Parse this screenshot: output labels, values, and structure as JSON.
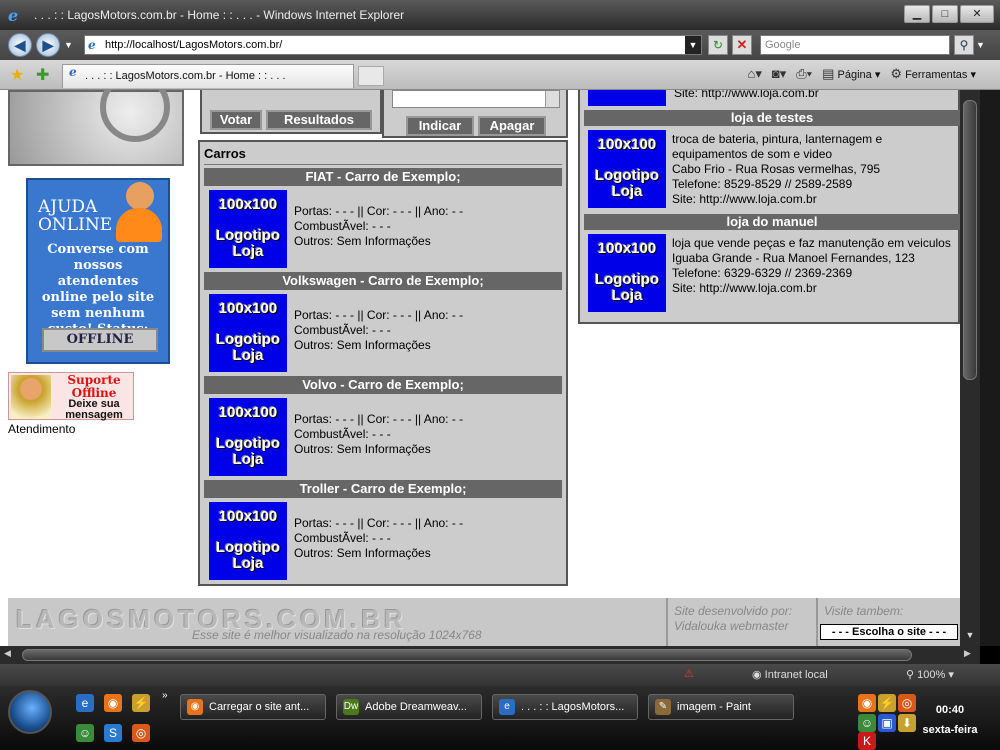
{
  "window": {
    "title": ". . . : : LagosMotors.com.br - Home : : . . . - Windows Internet Explorer",
    "minimize": "▁",
    "maximize": "□",
    "close": "✕"
  },
  "browser": {
    "address": "http://localhost/LagosMotors.com.br/",
    "search_placeholder": "Google",
    "tab_title": ". . . : : LagosMotors.com.br - Home : : . . .",
    "menu_pagina": "Página",
    "menu_ferramentas": "Ferramentas",
    "status_zone": "Intranet local",
    "zoom": "100%"
  },
  "left": {
    "ajuda_title": "AJUDA ONLINE",
    "ajuda_text": "Converse com nossos atendentes online pelo site sem nenhum custo! Status:",
    "status_button": "OFFLINE",
    "suporte_title": "Suporte Offline",
    "suporte_sub": "Deixe sua mensagem",
    "atendimento": "Atendimento"
  },
  "poll": {
    "votar": "Votar",
    "resultados": "Resultados"
  },
  "indicate": {
    "indicar": "Indicar",
    "apagar": "Apagar"
  },
  "carros": {
    "title": "Carros",
    "logo_l1": "100x100",
    "logo_l2": "Logotipo Loja",
    "items": [
      {
        "header": "FIAT - Carro de Exemplo;",
        "line1": "Portas: - - - || Cor: - - - || Ano: - -",
        "line2": "CombustÃvel: - - -",
        "line3": "Outros: Sem Informações"
      },
      {
        "header": "Volkswagen - Carro de Exemplo;",
        "line1": "Portas: - - - || Cor: - - - || Ano: - -",
        "line2": "CombustÃvel: - - -",
        "line3": "Outros: Sem Informações"
      },
      {
        "header": "Volvo - Carro de Exemplo;",
        "line1": "Portas: - - - || Cor: - - - || Ano: - -",
        "line2": "CombustÃvel: - - -",
        "line3": "Outros: Sem Informações"
      },
      {
        "header": "Troller - Carro de Exemplo;",
        "line1": "Portas: - - - || Cor: - - - || Ano: - -",
        "line2": "CombustÃvel: - - -",
        "line3": "Outros: Sem Informações"
      }
    ]
  },
  "lojas": {
    "top_site": "Site: http://www.loja.com.br",
    "items": [
      {
        "header": "loja de testes",
        "line1": "troca de bateria, pintura, lanternagem e",
        "line2": "equipamentos de som e video",
        "line3": "Cabo Frio - Rua Rosas vermelhas, 795",
        "line4": "Telefone: 8529-8529 // 2589-2589",
        "line5": "Site: http://www.loja.com.br"
      },
      {
        "header": "loja do manuel",
        "line1": "loja que vende peças e faz manutenção em veiculos",
        "line2": "Iguaba Grande - Rua Manoel Fernandes, 123",
        "line3": "Telefone: 6329-6329 // 2369-2369",
        "line4": "Site: http://www.loja.com.br",
        "line5": ""
      }
    ]
  },
  "footer": {
    "brand": "LAGOSMOTORS.COM.BR",
    "resolution": "Esse site é melhor visualizado na resolução 1024x768",
    "dev_line1": "Site desenvolvido por:",
    "dev_line2": "Vidalouka webmaster",
    "visite": "Visite tambem:",
    "select": "- - - Escolha o site - - -"
  },
  "taskbar": {
    "tasks": [
      "Carregar o site ant...",
      "Adobe Dreamweav...",
      ". . . : : LagosMotors...",
      "imagem - Paint"
    ],
    "clock": "00:40",
    "day": "sexta-feira"
  }
}
